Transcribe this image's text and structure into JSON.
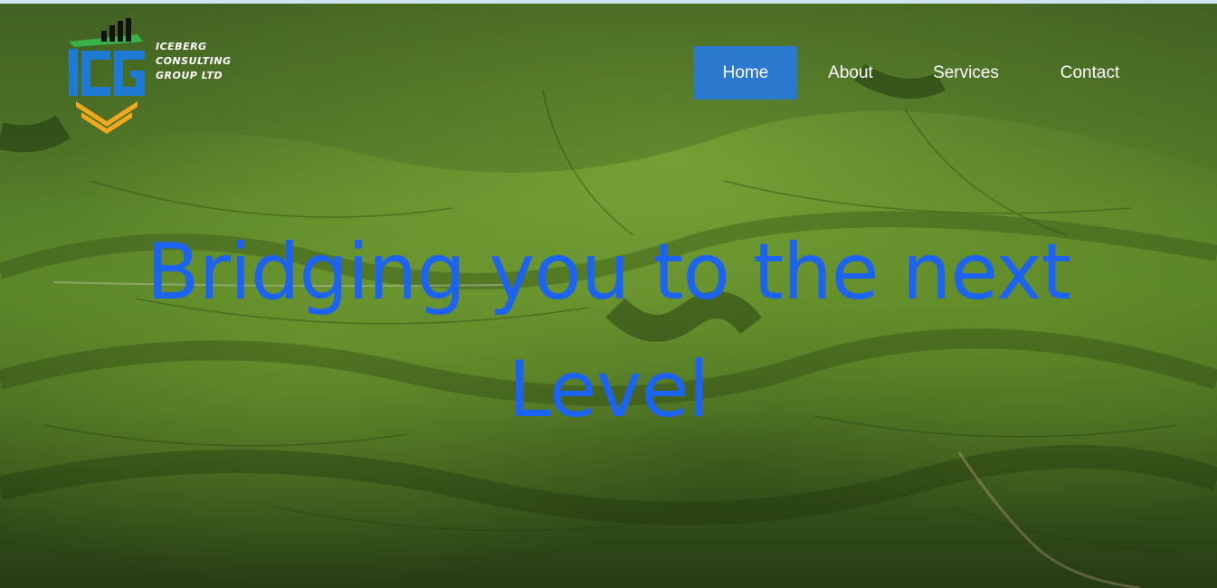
{
  "brand": {
    "name_lines": [
      "ICEBERG",
      "CONSULTING",
      "GROUP LTD"
    ],
    "logo_icon": "icg-monogram-logo-icon"
  },
  "nav": {
    "items": [
      {
        "label": "Home",
        "active": true
      },
      {
        "label": "About",
        "active": false
      },
      {
        "label": "Services",
        "active": false
      },
      {
        "label": "Contact",
        "active": false
      }
    ]
  },
  "hero": {
    "title": "Bridging you to the next Level",
    "background": "aerial-green-hills-photo"
  },
  "colors": {
    "accent": "#2b78cf",
    "title": "#1d63f2",
    "logo_blue": "#1f7ad6",
    "logo_green": "#37b34a",
    "logo_orange": "#f2a81d",
    "nav_text": "#ffffff"
  }
}
